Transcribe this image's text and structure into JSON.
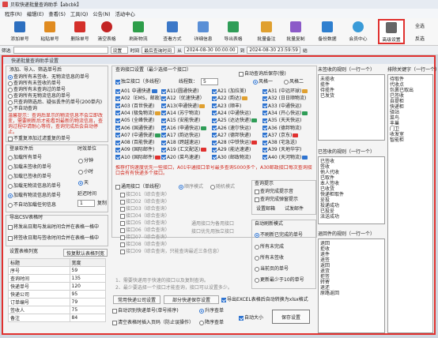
{
  "window": {
    "title": "贝软快递批量查询助手【abcbk】"
  },
  "menu": [
    "程序(R)",
    "编辑(E)",
    "查看(S)",
    "工具(Q)",
    "公告(N)",
    "活动中心"
  ],
  "toolbar": {
    "buttons": [
      {
        "label": "添加单号",
        "color": "#2d6fbf"
      },
      {
        "label": "粘贴单号",
        "color": "#e08b20"
      },
      {
        "label": "删除单号",
        "color": "#d4302a"
      },
      {
        "label": "清空表格",
        "color": "#c32424"
      },
      {
        "label": "刷新物流",
        "color": "#2e9e4a"
      },
      {
        "label": "查看方式",
        "color": "#3c78c8"
      },
      {
        "label": "详细信息",
        "color": "#5a8fd6"
      },
      {
        "label": "导出表格",
        "color": "#2f9d57"
      },
      {
        "label": "批量备注",
        "color": "#e0a030"
      },
      {
        "label": "批量复制",
        "color": "#8c5ac8"
      },
      {
        "label": "备份数据",
        "color": "#2f7fcf"
      },
      {
        "label": "会员中心",
        "color": "#3a9bd8"
      },
      {
        "label": "高级设置",
        "color": "#666666"
      }
    ],
    "right_labels": [
      "全选",
      "反选"
    ]
  },
  "filterbar": {
    "label1": "筛选",
    "label2": "时间",
    "label3": "最后查询时间",
    "label4": "从",
    "from": "2024-08-30 00:00:00",
    "label5": "到",
    "to": "2024-08-30 23:59:59",
    "label6": "结",
    "dd1": "设置",
    "dd2": "单号是否包含"
  },
  "dialog": {
    "title": "快递批量查询助手设置",
    "left": {
      "section_title": "添加、导入、筛选单号后",
      "radios": [
        "查询所有未签收、无物流信息的单号",
        "查询所有未签收的单号",
        "查询所有未查询过的单号",
        "查询所有无物流信息的单号",
        "只查询筛选后、疑似丢件的单号(200单内)",
        "不自动查询"
      ],
      "note": "温馨提示：查询后显示的物流信息不会立即改变，需要刷新后才能看到最新的物流信息，查询过程中请耐心等待，查询完成后会自动停止。",
      "auto_label": "不重复添加过滤重复的单号",
      "login_title": "登录软件后",
      "login_opts": [
        "加载所有单号",
        "加载未签收的单号",
        "加载已签收的单号",
        "加载无物流信息的单号",
        "加载有物流信息的单号",
        "不自动加载任何信息"
      ],
      "timer_title": "时效单位",
      "timer_opts": [
        "分钟",
        "小时",
        "天"
      ],
      "delay_label": "延迟时间",
      "delay_value": "1",
      "delay_unit": "复制",
      "export_title": "导出CSV表格时",
      "export_opts": [
        "将发出日期与发出时间合并在表格一格中",
        "将签收日期与签收时间合并在表格一格中"
      ],
      "grid_title": "设置表格列宽",
      "grid_reset": "恢复默认表格列宽",
      "grid_head": [
        "标题",
        "宽度"
      ],
      "grid_rows": [
        [
          "序号",
          "59"
        ],
        [
          "查询时间",
          "135"
        ],
        [
          "快递单号",
          "120"
        ],
        [
          "快递公司",
          "95"
        ],
        [
          "订单编号",
          "79"
        ],
        [
          "签收人",
          "75"
        ],
        [
          "备注",
          "84"
        ]
      ]
    },
    "mid": {
      "title": "查询接口设置（最少选择一个接口）",
      "auto_save": "自动查询后保存(慢)",
      "independent": "独立接口（多线程）",
      "threads_label": "线程数：",
      "threads_value": "5",
      "wind_opts": [
        "风格一",
        "风格二"
      ],
      "apis": [
        [
          "A01 中通快递",
          "A11(圆通快递)",
          "A21 (加拉美)",
          "A31 (中远环球)"
        ],
        [
          "A02（EMS，邮政）",
          "A12（优速快递）",
          "A22 (韵达)",
          "A32 (日日顺物流)"
        ],
        [
          "A03 (百世快递)",
          "A13(申通快递)",
          "A23 (顺丰)",
          "A33 (中通快运)"
        ],
        [
          "A04 (极兔物流)",
          "A14 (苏宁物流)",
          "A24 (中通快运)",
          "A34 (开心快运)"
        ],
        [
          "A05 (全峰快递)",
          "A15 (安能快递)",
          "A25 (达达快递)",
          "A35 (天天快运)"
        ],
        [
          "A06 (国通快递)",
          "A16 (申通快运)",
          "A26 (速尔快运)",
          "A36 (德邦物流)"
        ],
        [
          "A07 (中通快递)",
          "A17 (韵达快运)",
          "A27 (德邦快递)",
          "A37 (京东)"
        ],
        [
          "A08 (百能快递)",
          "A18 (跨越速运)",
          "A28 (中铁快运)",
          "A38 (宅急送)"
        ],
        [
          "A09 (国际邮件)",
          "A19 (汇文配送)",
          "A29 (能达速递)",
          "A39 (天地华宇)"
        ],
        [
          "A10 (国际邮件)",
          "A20 (菜鸟速递)",
          "A30 (邮政物流)",
          "A40 (天河物流)"
        ]
      ],
      "api_note": "推荐打钩速度优先一些接口，A01中通接口单号最多查询5000多个，A30邮政接口每次查询接口会有有快递多个接口。",
      "general": "通用接口（单线程）",
      "general_opts": [
        "顺序模式",
        "随机模式"
      ],
      "gen_items": [
        "接口01（综合查询）",
        "接口02（综合查询）",
        "接口03（综合查询）",
        "接口04（综合查询）",
        "接口05（综合查询）",
        "接口06（综合查询）",
        "接口07（综合查询）",
        "接口08（综合查询）",
        "接口09（综合查询，只能查询最近三条信息）"
      ],
      "gen_note1": "通用接口为备用接口",
      "gen_note2": "接口优先用独立接口",
      "foot1": "1、需要快递用于快速的接口以及复制查询。",
      "foot2": "2、最少要选择一个接口才能查询，接口可以设置多少。"
    },
    "query_hint": {
      "title": "查询提示",
      "opts": [
        "查询完成提示音",
        "查询完成弹窗提示"
      ],
      "btns": [
        "设置邮箱",
        "试发邮件"
      ]
    },
    "auto_refresh": {
      "title": "自动刷新模式",
      "opts": [
        "不刷新已完成的单号",
        "所有未完成",
        "所有未签收",
        "当前页的单号",
        "更新最少于10的单号"
      ]
    },
    "bottom": {
      "common_btn": "常用快递公司设置",
      "part_btn": "部分快递保存设置",
      "excel_opt": "导出EXCEL表格后自动转换为xlsx格式",
      "auto_detect": "自动识别快递单号(单号排序)",
      "asc": "升序查单",
      "auto_size": "自动大小",
      "clear_opt": "清空表格时插入页码（防止误操作）",
      "desc": "降序查单",
      "save": "保存设置"
    },
    "right": {
      "unsigned_title": "未签收的规则（一行一个）",
      "unsigned_rules": [
        "未揽收",
        "揽件",
        "待揽件",
        "已发货"
      ],
      "keyword_title": "排除关键字（一行一个）",
      "keyword_rules": [
        "待取件",
        "代收点",
        "包裹已取出",
        "已签收",
        "自提柜",
        "快递柜",
        "驿站",
        "菜鸟",
        "丰巢",
        "门卫",
        "收发室",
        "智能柜"
      ],
      "signed_title": "已签收的规则（一行一个）",
      "signed_rules": [
        "已签收",
        "签收",
        "他人代收",
        "已取件",
        "本人签收",
        "已收货",
        "快递柜取件",
        "妥投",
        "投递成功",
        "已投妥",
        "派送成功",
        "已交付"
      ],
      "return_title": "退回件的规则（一行一个）",
      "return_rules": [
        "退回",
        "拒收",
        "退件",
        "退签",
        "返回",
        "退货",
        "拒签",
        "转寄",
        "退还",
        "原路返回"
      ]
    }
  }
}
